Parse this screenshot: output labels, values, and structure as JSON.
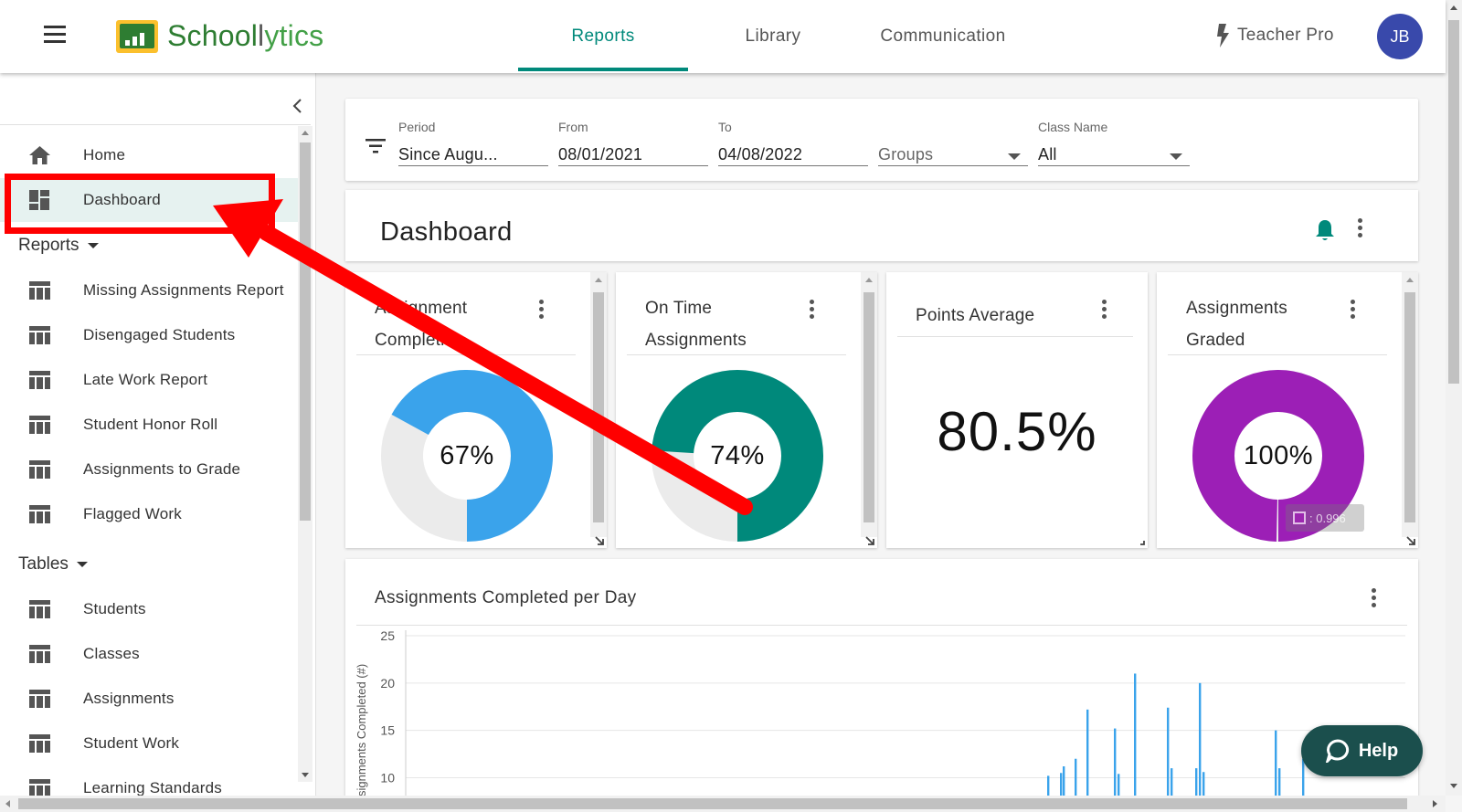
{
  "app": {
    "name_part1": "School",
    "name_part2": "ytics",
    "tier": "Teacher Pro",
    "user_initials": "JB"
  },
  "nav": {
    "tabs": [
      {
        "label": "Reports",
        "active": true
      },
      {
        "label": "Library",
        "active": false
      },
      {
        "label": "Communication",
        "active": false
      }
    ]
  },
  "sidebar": {
    "home": "Home",
    "dashboard": "Dashboard",
    "reports_section": "Reports",
    "reports": [
      "Missing Assignments Report",
      "Disengaged Students",
      "Late Work Report",
      "Student Honor Roll",
      "Assignments to Grade",
      "Flagged Work"
    ],
    "tables_section": "Tables",
    "tables": [
      "Students",
      "Classes",
      "Assignments",
      "Student Work",
      "Learning Standards"
    ]
  },
  "filters": {
    "period_label": "Period",
    "period_value": "Since Augu...",
    "from_label": "From",
    "from_value": "08/01/2021",
    "to_label": "To",
    "to_value": "04/08/2022",
    "groups_placeholder": "Groups",
    "class_label": "Class Name",
    "class_value": "All"
  },
  "dashboard": {
    "title": "Dashboard",
    "kpis": [
      {
        "title": "Assignment Completion",
        "value": 67,
        "display": "67%",
        "color": "#3aa3eb",
        "rest_color": "#ebebeb"
      },
      {
        "title": "On Time Assignments",
        "value": 74,
        "display": "74%",
        "color": "#00897b",
        "rest_color": "#ebebeb"
      },
      {
        "title": "Points Average",
        "display": "80.5%"
      },
      {
        "title": "Assignments Graded",
        "value": 99.6,
        "display": "100%",
        "color": "#9c1fb6",
        "rest_color": "#ebebeb",
        "tooltip": ": 0.996"
      }
    ],
    "chart_title": "Assignments Completed per Day"
  },
  "chart_data": {
    "type": "bar",
    "title": "Assignments Completed per Day",
    "ylabel": "Assignments Completed (#)",
    "yticks": [
      10,
      15,
      20,
      25
    ],
    "ylim": [
      8.5,
      25
    ],
    "series_color": "#3aa3eb",
    "bars": [
      {
        "x": 1,
        "y": 10.2
      },
      {
        "x": 2,
        "y": 10.5
      },
      {
        "x": 3,
        "y": 11.2
      },
      {
        "x": 4,
        "y": 12.0
      },
      {
        "x": 5,
        "y": 17.2
      },
      {
        "x": 6,
        "y": 15.2
      },
      {
        "x": 7,
        "y": 10.4
      },
      {
        "x": 8,
        "y": 21.0
      },
      {
        "x": 9,
        "y": 17.4
      },
      {
        "x": 10,
        "y": 11.0
      },
      {
        "x": 11,
        "y": 11.0
      },
      {
        "x": 12,
        "y": 20.0
      },
      {
        "x": 13,
        "y": 10.6
      },
      {
        "x": 14,
        "y": 15.0
      },
      {
        "x": 15,
        "y": 11.0
      },
      {
        "x": 16,
        "y": 12.0
      }
    ]
  },
  "help": {
    "label": "Help"
  },
  "annotation_color": "#ff0000"
}
